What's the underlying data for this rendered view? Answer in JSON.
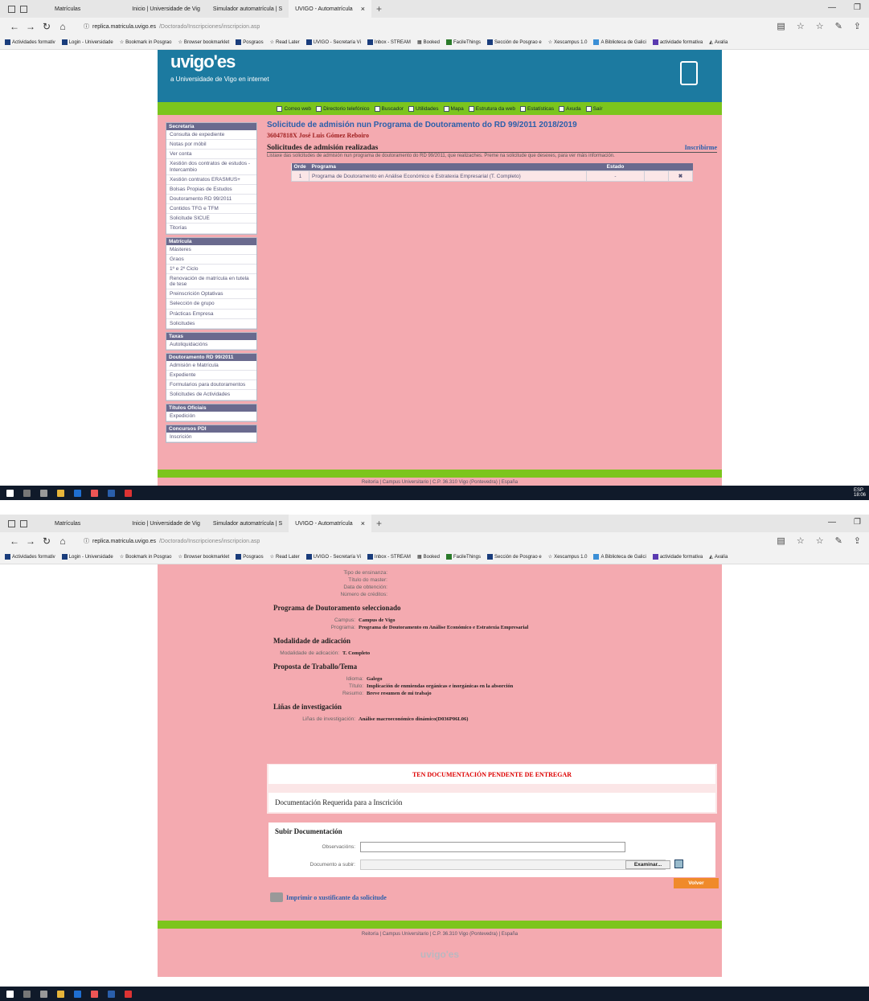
{
  "browser": {
    "tabs": [
      "Matrículas",
      "Inicio | Universidade de Vig",
      "Simulador automatrícula | S",
      "UVIGO - Automatrícula"
    ],
    "url_host": "replica.matricula.uvigo.es",
    "url_path": "/Doctorado/Inscripciones/inscripcion.asp",
    "bookmarks": [
      "Actividades formativ",
      "Login - Universidade",
      "Bookmark in Posgrao",
      "Browser bookmarklet",
      "Posgraos",
      "Read Later",
      "UVIGO - Secretaría Vi",
      "Inbox - STREAM",
      "Booked",
      "FacileThings",
      "Sección de Posgrao e",
      "Xescampus 1.0",
      "A Biblioteca de Galici",
      "actividade formativa",
      "Avalía"
    ]
  },
  "site": {
    "logo": "uvigo'es",
    "tagline": "a Universidade de Vigo en internet",
    "topnav": [
      "Correo web",
      "Directorio telefónico",
      "Buscador",
      "Utilidades",
      "Mapa",
      "Estrutura da web",
      "Estatísticas",
      "Axuda",
      "Saír"
    ],
    "footer": "Reitoría | Campus Universitario | C.P. 36.310 Vigo (Pontevedra) | España",
    "footer_logo": "uvigo'es"
  },
  "sidebar": [
    {
      "title": "Secretaría",
      "items": [
        "Consulta de expediente",
        "Notas por móbil",
        "Ver conta",
        "Xestión dos contratos de estudos - Intercambio",
        "Xestión contratos ERASMUS+",
        "Bolsas Propias de Estudos",
        "Doutoramento RD 99/2011",
        "Contidos TFG e TFM",
        "Solicitude SICUE",
        "Titorías"
      ]
    },
    {
      "title": "Matrícula",
      "items": [
        "Másteres",
        "Graos",
        "1º e 2º Ciclo",
        "Renovación de matrícula en tutela de tese",
        "Preinscrición Optativas",
        "Selección de grupo",
        "Prácticas Empresa",
        "Solicitudes"
      ]
    },
    {
      "title": "Taxas",
      "items": [
        "Autoliquidacións"
      ]
    },
    {
      "title": "Doutoramento RD 99/2011",
      "items": [
        "Admisión e Matrícula",
        "Expediente",
        "Formularios para doutoramentos",
        "Solicitudes de Actividades"
      ]
    },
    {
      "title": "Títulos Oficiais",
      "items": [
        "Expedición"
      ]
    },
    {
      "title": "Concursos PDI",
      "items": [
        "Inscrición"
      ]
    }
  ],
  "page1": {
    "title": "Solicitude de admisión nun Programa de Doutoramento do RD 99/2011 2018/2019",
    "user": "36047818X José Luis Gómez Reboiro",
    "subtitle": "Solicitudes de admisión realizadas",
    "enroll_link": "Inscribirme",
    "note": "Listaxe das solicitudes de admisión nun programa de doutoramento do RD 99/2011, que realizaches. Preme na solicitude que desexes, para ver máis información.",
    "table": {
      "headers": [
        "Orde",
        "Programa",
        "Estado"
      ],
      "rows": [
        {
          "orde": "1",
          "programa": "Programa de Doutoramento en Análise Económico e Estratexia Empresarial (T. Completo)",
          "estado": "-"
        }
      ]
    }
  },
  "page2": {
    "top_fields": [
      {
        "k": "Tipo de ensinanza:",
        "v": ""
      },
      {
        "k": "Título do master:",
        "v": ""
      },
      {
        "k": "Data de obtención:",
        "v": ""
      },
      {
        "k": "Número de créditos:",
        "v": ""
      }
    ],
    "programa_h": "Programa de Doutoramento seleccionado",
    "programa_fields": [
      {
        "k": "Campus:",
        "v": "Campus de Vigo"
      },
      {
        "k": "Programa:",
        "v": "Programa de Doutoramento en Análise Económico e Estratexia Empresarial"
      }
    ],
    "modalidade_h": "Modalidade de adicación",
    "modalidade_fields": [
      {
        "k": "Modalidade de adicación:",
        "v": "T. Completo"
      }
    ],
    "proposta_h": "Proposta de Traballo/Tema",
    "proposta_fields": [
      {
        "k": "Idioma:",
        "v": "Galego"
      },
      {
        "k": "Título:",
        "v": "Implicación de enmiendas orgánicas e inorgánicas en la absorción"
      },
      {
        "k": "Resumo:",
        "v": "Breve resumen de mi trabajo"
      }
    ],
    "linas_h": "Liñas de investigación",
    "linas_fields": [
      {
        "k": "Liñas de investigación:",
        "v": "Análise macroeconómico dinámico(D036P06L06)"
      }
    ],
    "pending": "TEN DOCUMENTACIÓN PENDENTE DE ENTREGAR",
    "docreq": "Documentación Requerida para a Inscrición",
    "upload_title": "Subir Documentación",
    "obs_label": "Observacións:",
    "doc_label": "Documento a subir:",
    "examinar": "Examinar...",
    "volver": "Volver",
    "print": "Imprimir o xustificante da solicitude"
  },
  "taskbar": {
    "tray": "ESP  18:06"
  }
}
